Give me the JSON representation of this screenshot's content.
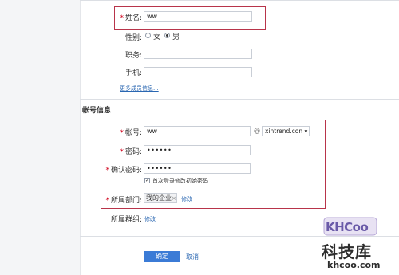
{
  "basic": {
    "name_label": "姓名:",
    "name_value": "ww",
    "gender_label": "性别:",
    "gender_options": [
      "女",
      "男"
    ],
    "gender_selected": "男",
    "position_label": "职务:",
    "phone_label": "手机:",
    "more_link": "更多成员信息..."
  },
  "account": {
    "section_title": "帐号信息",
    "account_label": "帐号:",
    "account_value": "ww",
    "at_symbol": "@",
    "domain_value": "xintrend.con ▾",
    "password_label": "密码:",
    "password_value": "••••••",
    "confirm_label": "确认密码:",
    "confirm_value": "••••••",
    "change_pwd_label": "首次登录修改初始密码",
    "change_pwd_checked": true,
    "dept_label": "所属部门:",
    "dept_tag": "我的企业",
    "dept_tag_close": "×",
    "dept_edit": "修改",
    "group_label": "所属群组:",
    "group_edit": "修改"
  },
  "actions": {
    "ok_label": "确定",
    "cancel_label": "取消"
  },
  "watermark": {
    "brand": "KHCoo",
    "cn": "科技库",
    "url": "khcoo.com"
  },
  "colors": {
    "highlight_border": "#b8344a",
    "primary_button": "#3b7bd6",
    "link": "#2a67b2"
  }
}
